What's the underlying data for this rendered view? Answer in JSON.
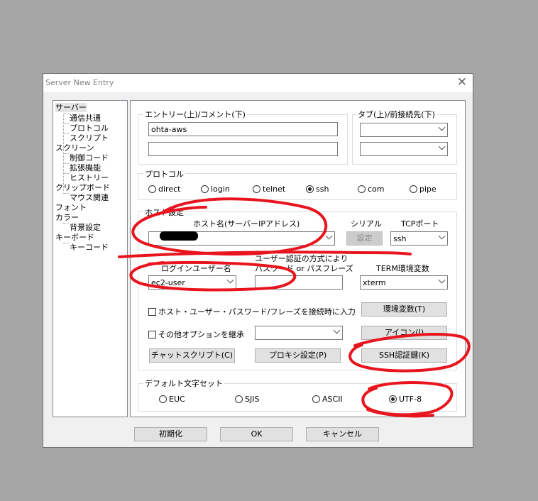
{
  "window": {
    "title": "Server New Entry",
    "close_glyph": "✕"
  },
  "tree": {
    "items": [
      {
        "label": "サーバー",
        "selected": true
      },
      {
        "label": "通信共通"
      },
      {
        "label": "プロトコル"
      },
      {
        "label": "スクリプト"
      },
      {
        "label": "スクリーン"
      },
      {
        "label": "制御コード"
      },
      {
        "label": "拡張機能"
      },
      {
        "label": "ヒストリー"
      },
      {
        "label": "クリップボード"
      },
      {
        "label": "マウス関連"
      },
      {
        "label": "フォント"
      },
      {
        "label": "カラー"
      },
      {
        "label": "背景設定"
      },
      {
        "label": "キーボード"
      },
      {
        "label": "キーコード"
      }
    ]
  },
  "entry": {
    "label": "エントリー(上)/コメント(下)",
    "value": "ohta-aws",
    "comment": ""
  },
  "tab": {
    "label": "タブ(上)/前接続先(下)",
    "tab_value": "",
    "prev_value": ""
  },
  "protocol": {
    "label": "プロトコル",
    "options": [
      "direct",
      "login",
      "telnet",
      "ssh",
      "com",
      "pipe"
    ],
    "selected": "ssh"
  },
  "host": {
    "group_label": "ホスト設定",
    "host_label": "ホスト名(サーバーIPアドレス)",
    "serial_label": "シリアル",
    "serial_button": "設定",
    "tcp_label": "TCPポート",
    "tcp_value": "ssh",
    "login_label": "ログインユーザー名",
    "login_value": "ec2-user",
    "auth_label_1": "ユーザー認証の方式により",
    "auth_label_2": "パスワード or パスフレーズ",
    "auth_value": "",
    "term_label": "TERM環境変数",
    "term_value": "xterm",
    "check_prompt": "ホスト・ユーザー・パスワード/フレーズを接続時に入力",
    "env_button": "環境変数(T)",
    "check_inherit": "その他オプションを継承",
    "inherit_value": "",
    "icon_button": "アイコン(I)",
    "chat_button": "チャットスクリプト(C)",
    "proxy_button": "プロキシ設定(P)",
    "ssh_button": "SSH認証鍵(K)"
  },
  "charset": {
    "label": "デフォルト文字セット",
    "options": [
      "EUC",
      "SJIS",
      "ASCII",
      "UTF-8"
    ],
    "selected": "UTF-8"
  },
  "footer": {
    "init_button": "初期化",
    "ok_button": "OK",
    "cancel_button": "キャンセル"
  },
  "colors": {
    "annotation_red": "#e8151f",
    "background": "#a6a6a6"
  }
}
